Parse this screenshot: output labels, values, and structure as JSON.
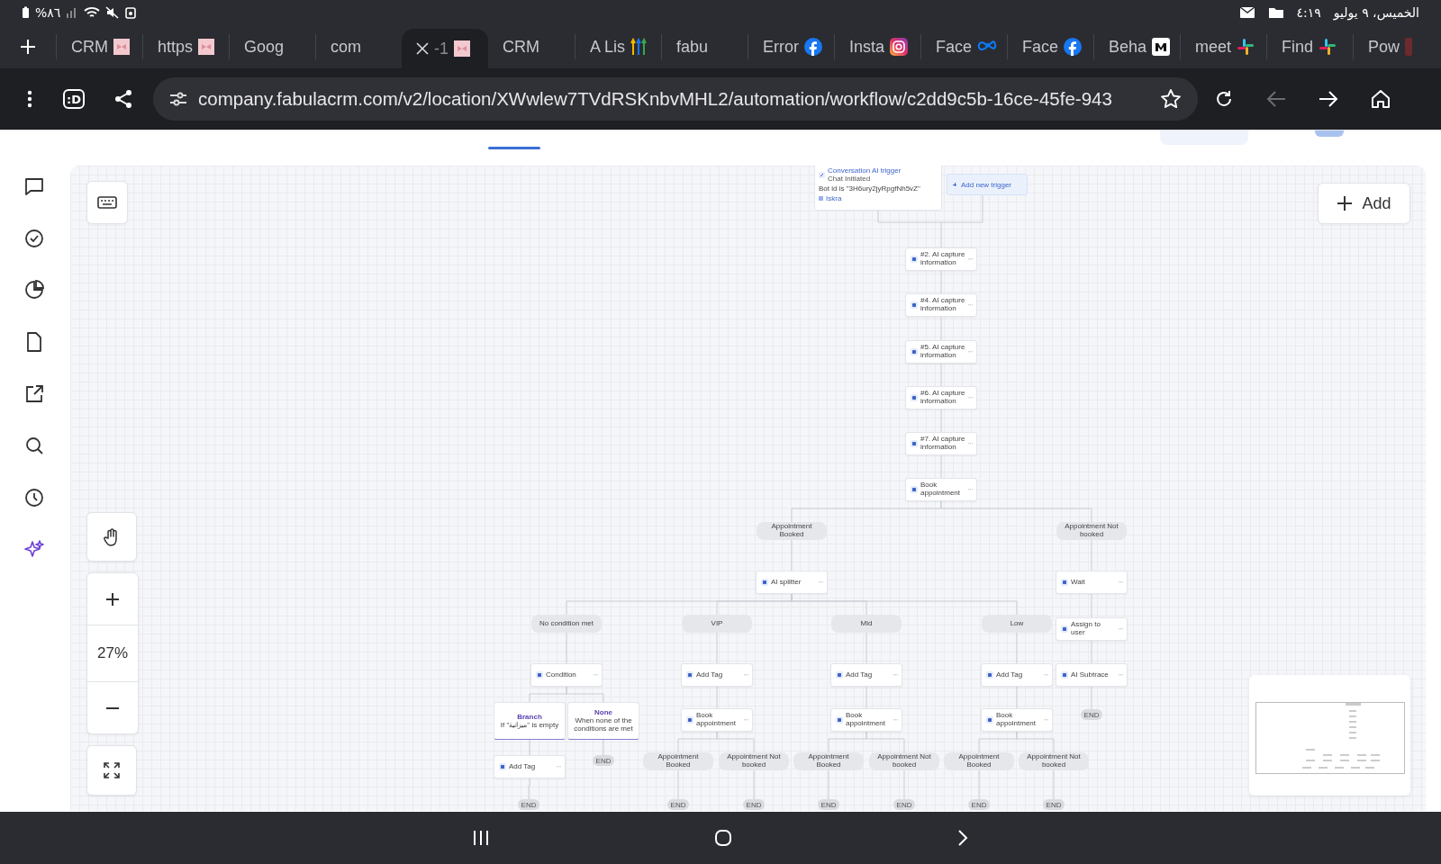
{
  "status_bar": {
    "battery": "%٨٦",
    "time": "٤:١٩",
    "date": "الخميس، ٩ يوليو"
  },
  "tabs": [
    {
      "label": "CRM",
      "selected": false
    },
    {
      "label": "https",
      "selected": false
    },
    {
      "label": "Goog",
      "selected": false
    },
    {
      "label": "com",
      "selected": false
    },
    {
      "label": "-1",
      "selected": true
    },
    {
      "label": "CRM",
      "selected": false
    },
    {
      "label": "A Lis",
      "selected": false
    },
    {
      "label": "fabu",
      "selected": false
    },
    {
      "label": "Error",
      "selected": false
    },
    {
      "label": "Insta",
      "selected": false
    },
    {
      "label": "Face",
      "selected": false
    },
    {
      "label": "Face",
      "selected": false
    },
    {
      "label": "Beha",
      "selected": false
    },
    {
      "label": "meet",
      "selected": false
    },
    {
      "label": "Find",
      "selected": false
    },
    {
      "label": "Pow",
      "selected": false
    }
  ],
  "toolbar": {
    "screenshot_label": ":D",
    "url": "company.fabulacrm.com/v2/location/XWwlew7TVdRSKnbvMHL2/automation/workflow/c2dd9c5b-16ce-45fe-943",
    "back_enabled": false
  },
  "header": {
    "toggle_on": true
  },
  "canvas": {
    "zoom": "27%",
    "add_button": "Add",
    "trigger": {
      "title": "Conversation AI trigger",
      "subtitle": "Chat Initiated",
      "condition": "Bot id is \"3H6ury2jyRpgfNh5vZ\"",
      "link": "Iskra"
    },
    "add_trigger": "Add new trigger",
    "nodes": [
      {
        "kind": "action",
        "label": "#2. AI capture information"
      },
      {
        "kind": "action",
        "label": "#4. AI capture information"
      },
      {
        "kind": "action",
        "label": "#5. AI capture information"
      },
      {
        "kind": "action",
        "label": "#6. AI capture information"
      },
      {
        "kind": "action",
        "label": "#7. AI capture information"
      },
      {
        "kind": "action",
        "label": "Book appointment"
      },
      {
        "kind": "label",
        "label": "Appointment Booked"
      },
      {
        "kind": "label",
        "label": "Appointment Not booked"
      },
      {
        "kind": "action",
        "label": "AI splitter"
      },
      {
        "kind": "action",
        "label": "Wait"
      },
      {
        "kind": "label",
        "label": "No condition met"
      },
      {
        "kind": "label",
        "label": "VIP"
      },
      {
        "kind": "label",
        "label": "Mid"
      },
      {
        "kind": "label",
        "label": "Low"
      },
      {
        "kind": "action",
        "label": "Assign to user"
      },
      {
        "kind": "action",
        "label": "Condition"
      },
      {
        "kind": "action",
        "label": "Add Tag"
      },
      {
        "kind": "action",
        "label": "Add Tag"
      },
      {
        "kind": "action",
        "label": "Add Tag"
      },
      {
        "kind": "action",
        "label": "AI Subtrace"
      },
      {
        "kind": "end",
        "label": "END"
      },
      {
        "kind": "branch",
        "label": "Branch",
        "detail": "If \"ميزانية\" is empty"
      },
      {
        "kind": "branch",
        "label": "None",
        "detail": "When none of the conditions are met"
      },
      {
        "kind": "action",
        "label": "Book appointment"
      },
      {
        "kind": "action",
        "label": "Book appointment"
      },
      {
        "kind": "action",
        "label": "Book appointment"
      },
      {
        "kind": "end",
        "label": "END"
      },
      {
        "kind": "action",
        "label": "Add Tag"
      },
      {
        "kind": "label",
        "label": "Appointment Booked"
      },
      {
        "kind": "label",
        "label": "Appointment Not booked"
      },
      {
        "kind": "label",
        "label": "Appointment Booked"
      },
      {
        "kind": "label",
        "label": "Appointment Not booked"
      },
      {
        "kind": "label",
        "label": "Appointment Booked"
      },
      {
        "kind": "label",
        "label": "Appointment Not booked"
      },
      {
        "kind": "end",
        "label": "END"
      },
      {
        "kind": "end",
        "label": "END"
      },
      {
        "kind": "end",
        "label": "END"
      },
      {
        "kind": "end",
        "label": "END"
      },
      {
        "kind": "end",
        "label": "END"
      },
      {
        "kind": "end",
        "label": "END"
      },
      {
        "kind": "end",
        "label": "END"
      }
    ]
  }
}
